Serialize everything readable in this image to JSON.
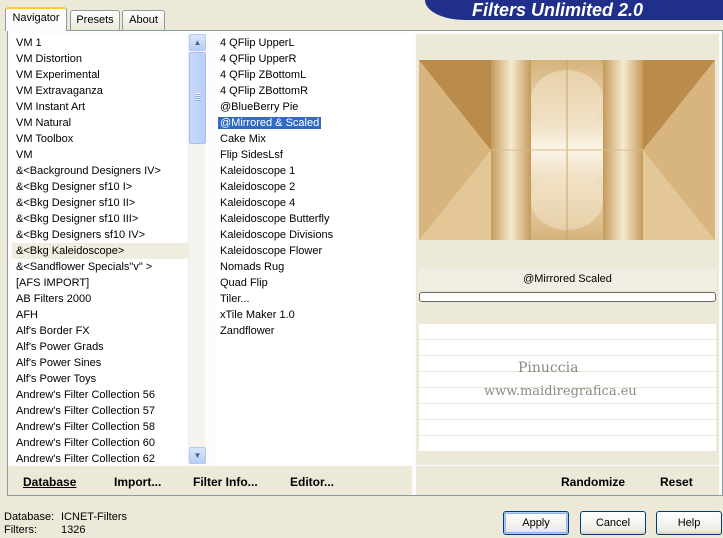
{
  "tabs": [
    {
      "label": "Navigator",
      "active": true
    },
    {
      "label": "Presets",
      "active": false
    },
    {
      "label": "About",
      "active": false
    }
  ],
  "banner_title": "Filters Unlimited 2.0",
  "categories": {
    "items": [
      "VM 1",
      "VM Distortion",
      "VM Experimental",
      "VM Extravaganza",
      "VM Instant Art",
      "VM Natural",
      "VM Toolbox",
      "VM",
      "&<Background Designers IV>",
      "&<Bkg Designer sf10 I>",
      "&<Bkg Designer sf10 II>",
      "&<Bkg Designer sf10 III>",
      "&<Bkg Designers sf10 IV>",
      "&<Bkg Kaleidoscope>",
      "&<Sandflower Specials\"v\" >",
      "[AFS IMPORT]",
      "AB Filters 2000",
      "AFH",
      "Alf's Border FX",
      "Alf's Power Grads",
      "Alf's Power Sines",
      "Alf's Power Toys",
      "Andrew's Filter Collection 56",
      "Andrew's Filter Collection 57",
      "Andrew's Filter Collection 58",
      "Andrew's Filter Collection 60",
      "Andrew's Filter Collection 62"
    ],
    "highlighted_index": 13
  },
  "filters": {
    "items": [
      "4 QFlip UpperL",
      "4 QFlip UpperR",
      "4 QFlip ZBottomL",
      "4 QFlip ZBottomR",
      "@BlueBerry Pie",
      "@Mirrored & Scaled",
      "Cake Mix",
      "Flip SidesLsf",
      "Kaleidoscope 1",
      "Kaleidoscope 2",
      "Kaleidoscope 4",
      "Kaleidoscope Butterfly",
      "Kaleidoscope Divisions",
      "Kaleidoscope Flower",
      "Nomads Rug",
      "Quad Flip",
      "Tiler...",
      "xTile Maker 1.0",
      "Zandflower"
    ],
    "selected_index": 5
  },
  "preview": {
    "filter_name": "@Mirrored  Scaled",
    "progress": 0
  },
  "watermark": {
    "line1": "Pinuccia",
    "line2": "www.maidiregrafica.eu"
  },
  "toolbar": {
    "database": "Database",
    "import": "Import...",
    "filter_info": "Filter Info...",
    "editor": "Editor...",
    "randomize": "Randomize",
    "reset": "Reset"
  },
  "status": {
    "database_label": "Database:",
    "database_value": "ICNET-Filters",
    "filters_label": "Filters:",
    "filters_value": "1326"
  },
  "buttons": {
    "apply": "Apply",
    "cancel": "Cancel",
    "help": "Help"
  },
  "colors": {
    "banner": "#1f2f8a",
    "selection": "#316ac5",
    "preview_tan": "#c8a064"
  }
}
